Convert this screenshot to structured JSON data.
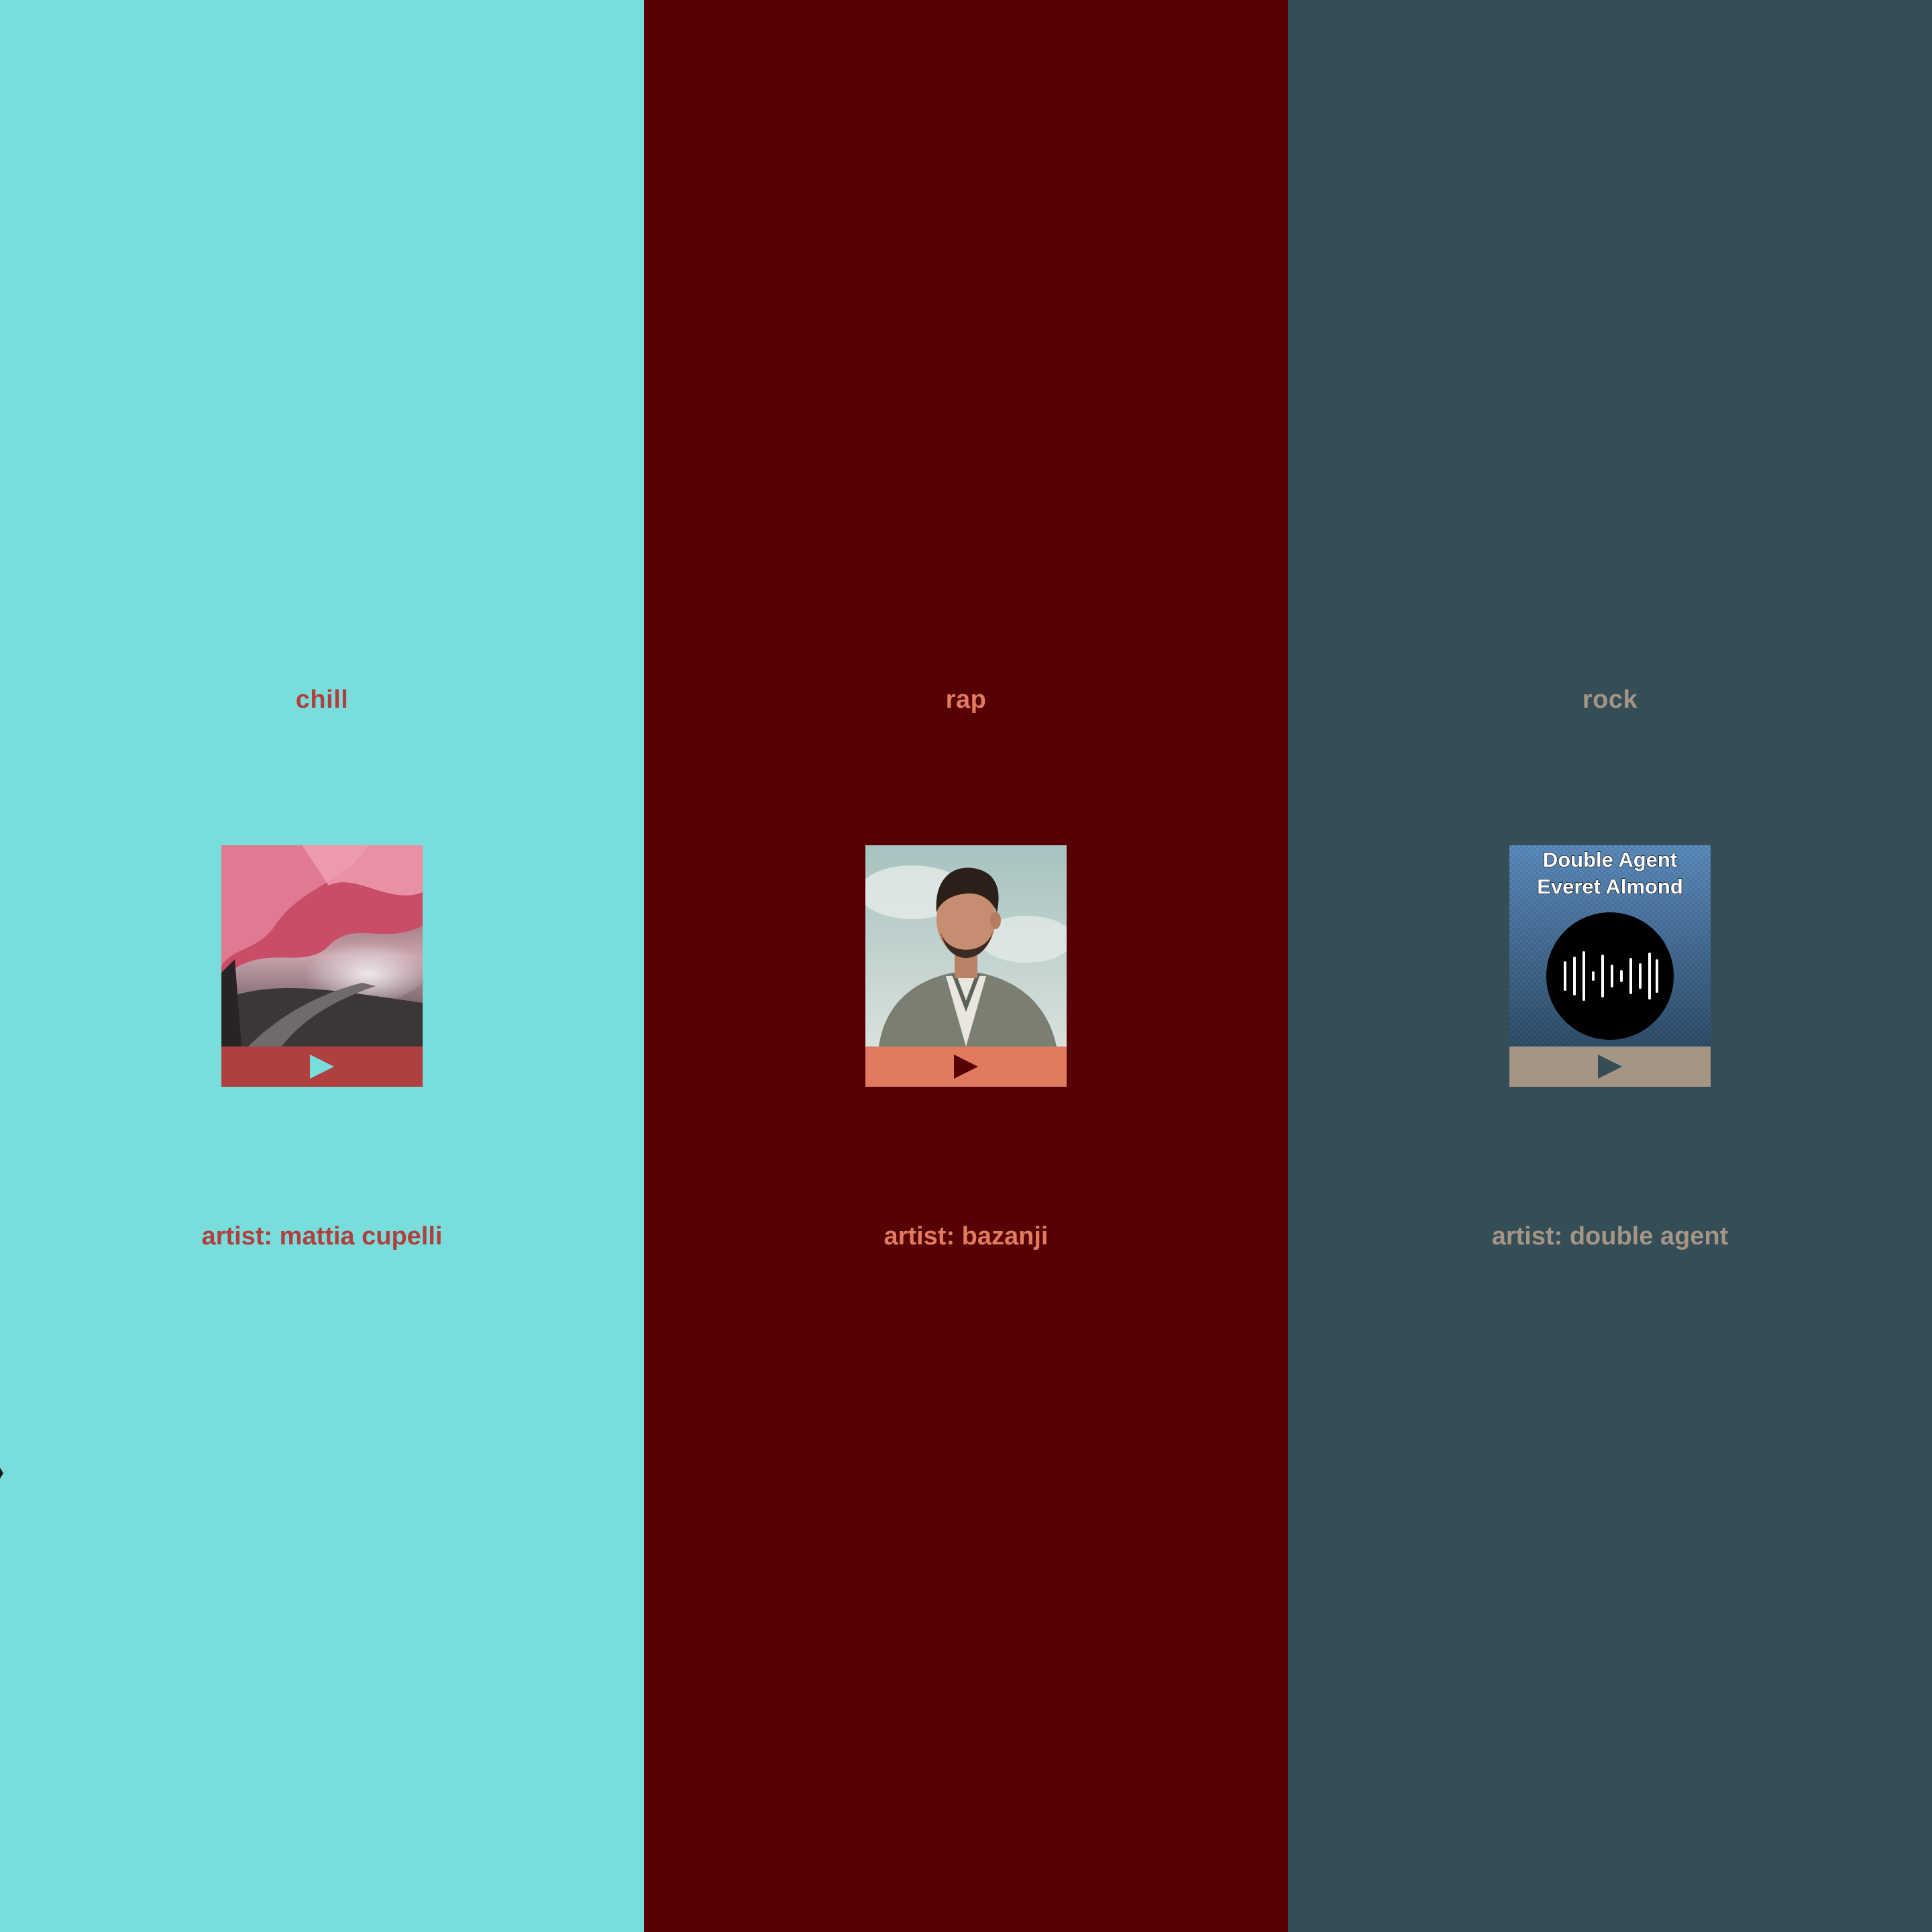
{
  "panels": [
    {
      "genre": "chill",
      "artist": "artist: mattia cupelli",
      "colors": {
        "bg": "#79dedb",
        "accent": "#b03f3f",
        "play_icon": "#79dedb"
      },
      "artwork": "red-forest-photo",
      "play_icon": "play-icon"
    },
    {
      "genre": "rap",
      "artist": "artist: bazanji",
      "colors": {
        "bg": "#570003",
        "accent": "#e07b5f",
        "play_icon": "#570003"
      },
      "artwork": "artist-portrait-photo",
      "play_icon": "play-icon"
    },
    {
      "genre": "rock",
      "artist": "artist: double agent",
      "colors": {
        "bg": "#354d57",
        "accent": "#a49585",
        "play_icon": "#354d57"
      },
      "artwork": "album-cover-soundwave",
      "artwork_text": [
        "Double Agent",
        "Everet Almond"
      ],
      "play_icon": "play-icon"
    }
  ]
}
